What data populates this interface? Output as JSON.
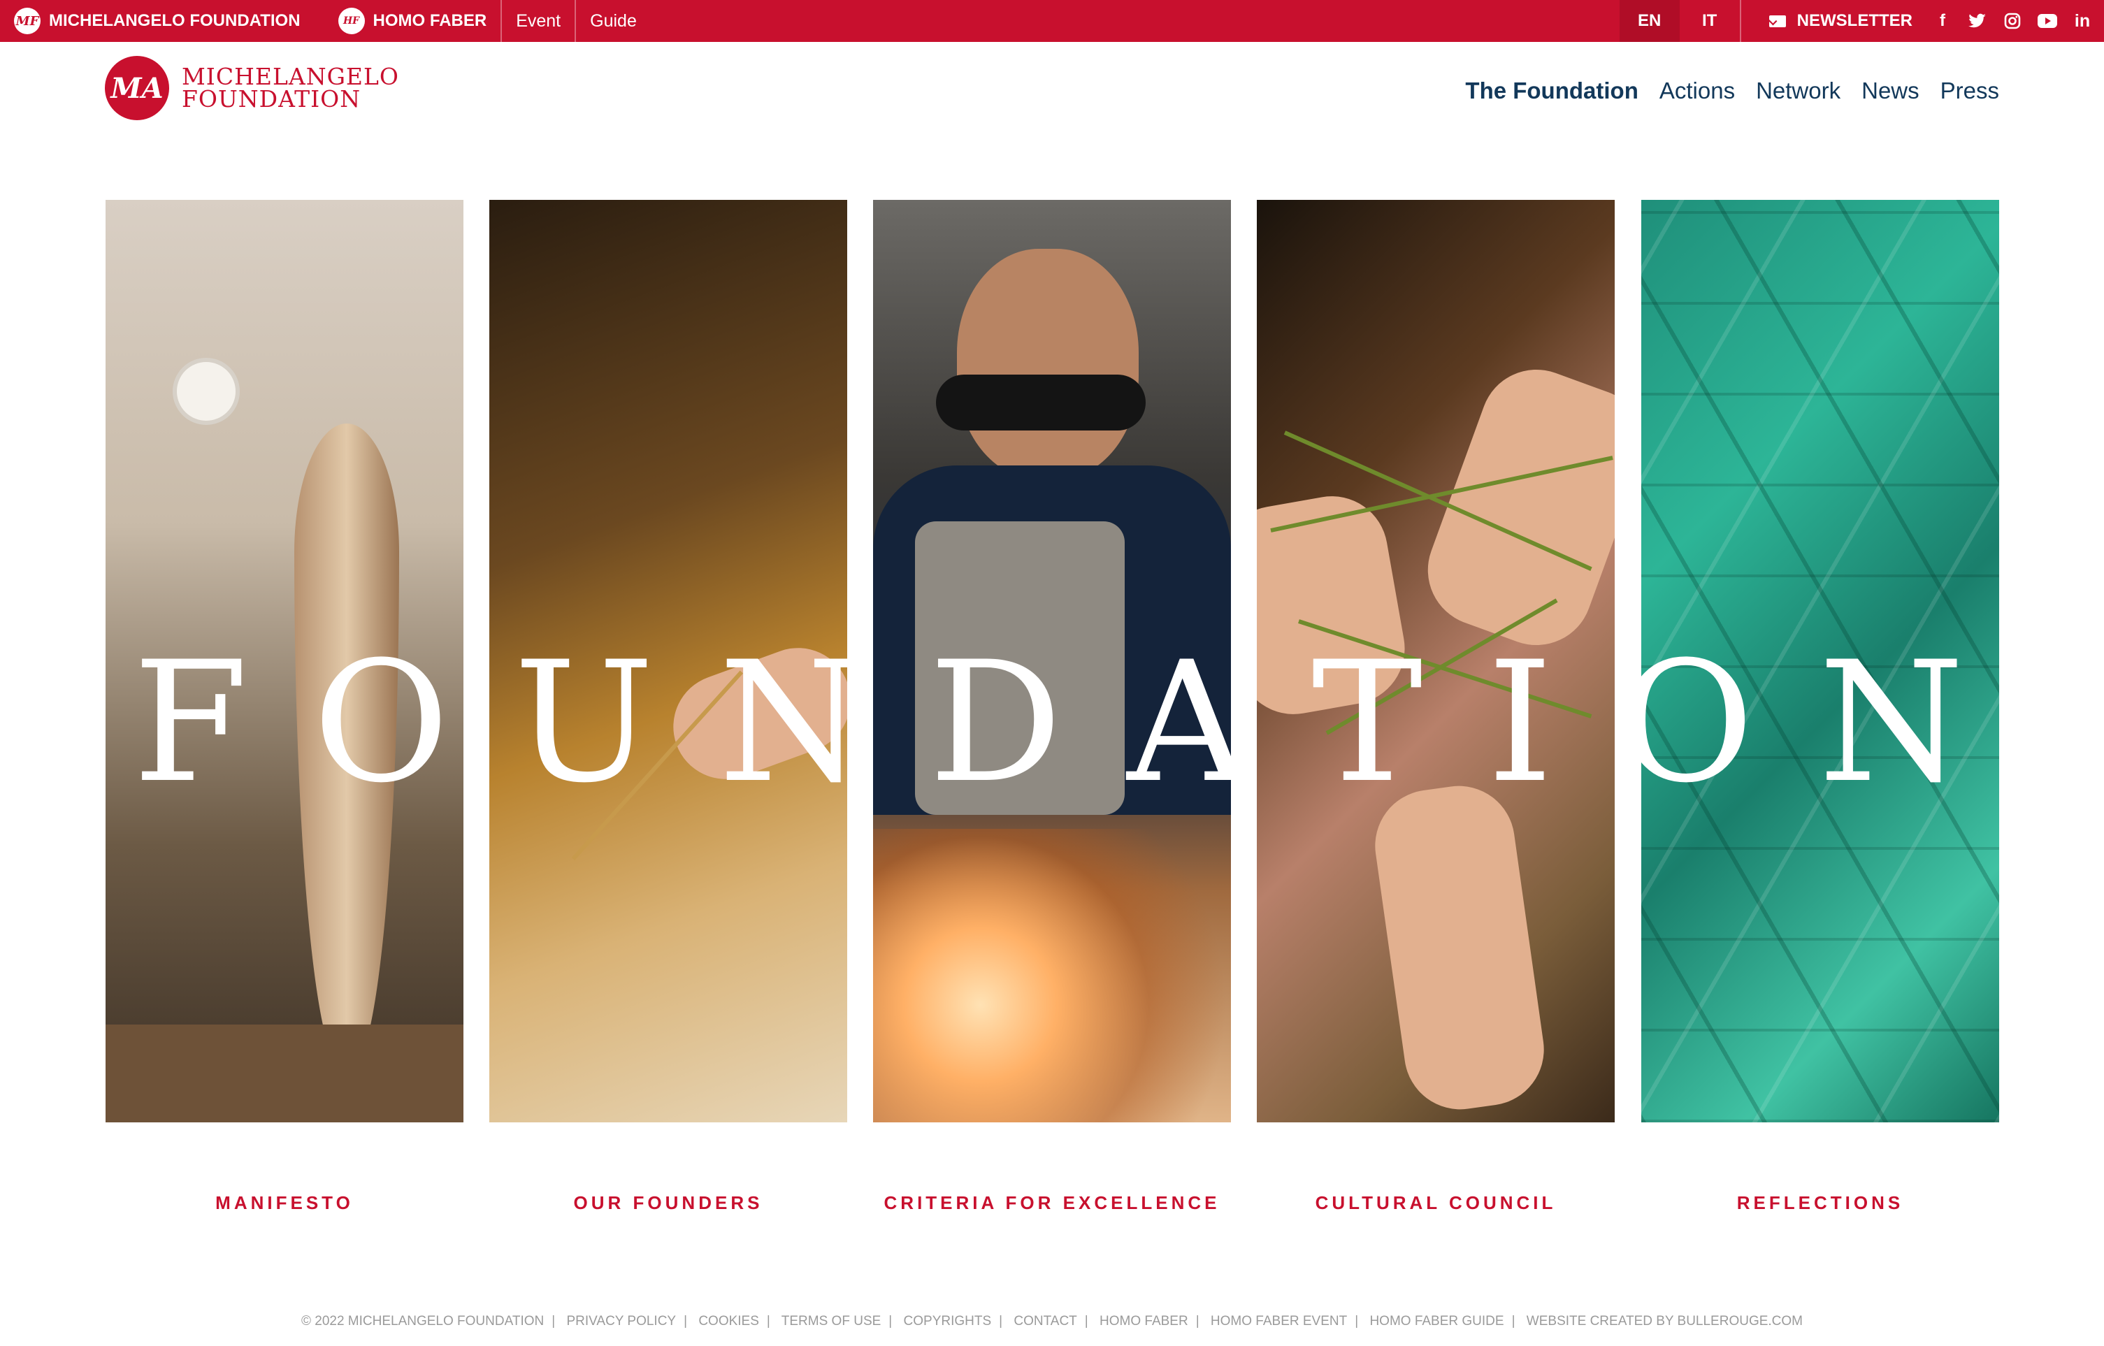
{
  "topbar": {
    "brand": "MICHELANGELO FOUNDATION",
    "homo_faber": "HOMO FABER",
    "event": "Event",
    "guide": "Guide",
    "lang_en": "EN",
    "lang_it": "IT",
    "newsletter": "NEWSLETTER",
    "social_icons": [
      "facebook-icon",
      "twitter-icon",
      "instagram-icon",
      "youtube-icon",
      "linkedin-icon"
    ]
  },
  "header": {
    "logo_line1": "MICHELANGELO",
    "logo_line2": "FOUNDATION",
    "nav": [
      "The Foundation",
      "Actions",
      "Network",
      "News",
      "Press"
    ]
  },
  "hero": {
    "letters": [
      "F",
      "O",
      "U",
      "N",
      "D",
      "A",
      "T",
      "I",
      "O",
      "N"
    ]
  },
  "sections": [
    "MANIFESTO",
    "OUR FOUNDERS",
    "CRITERIA FOR EXCELLENCE",
    "CULTURAL COUNCIL",
    "REFLECTIONS"
  ],
  "footer": {
    "items": [
      "© 2022 MICHELANGELO FOUNDATION",
      "PRIVACY POLICY",
      "COOKIES",
      "TERMS OF USE",
      "COPYRIGHTS",
      "CONTACT",
      "HOMO FABER",
      "HOMO FABER EVENT",
      "HOMO FABER GUIDE",
      "WEBSITE CREATED BY BULLEROUGE.COM"
    ]
  },
  "colors": {
    "brand_red": "#c8102e",
    "nav_blue": "#12385a",
    "footer_gray": "#9a9a9a"
  }
}
